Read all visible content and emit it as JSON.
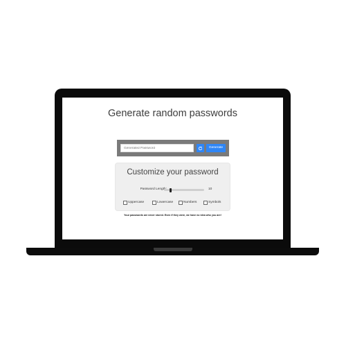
{
  "header": {
    "title": "Generate random passwords"
  },
  "generator": {
    "password_placeholder": "Generated Password",
    "refresh_icon": "refresh-icon",
    "generate_label": "Generate",
    "button_color": "#2f86f6"
  },
  "customize": {
    "title": "Customize your password",
    "length_label": "Password Length:",
    "length_value": "10",
    "slider_fraction": 0.15,
    "options": [
      {
        "label": "Uppercase",
        "checked": false
      },
      {
        "label": "Lowercase",
        "checked": false
      },
      {
        "label": "Numbers",
        "checked": false
      },
      {
        "label": "Symbols",
        "checked": false
      }
    ]
  },
  "footer": {
    "note": "Your passwords are never stored. Even if they were, we have no idea who you are!"
  }
}
